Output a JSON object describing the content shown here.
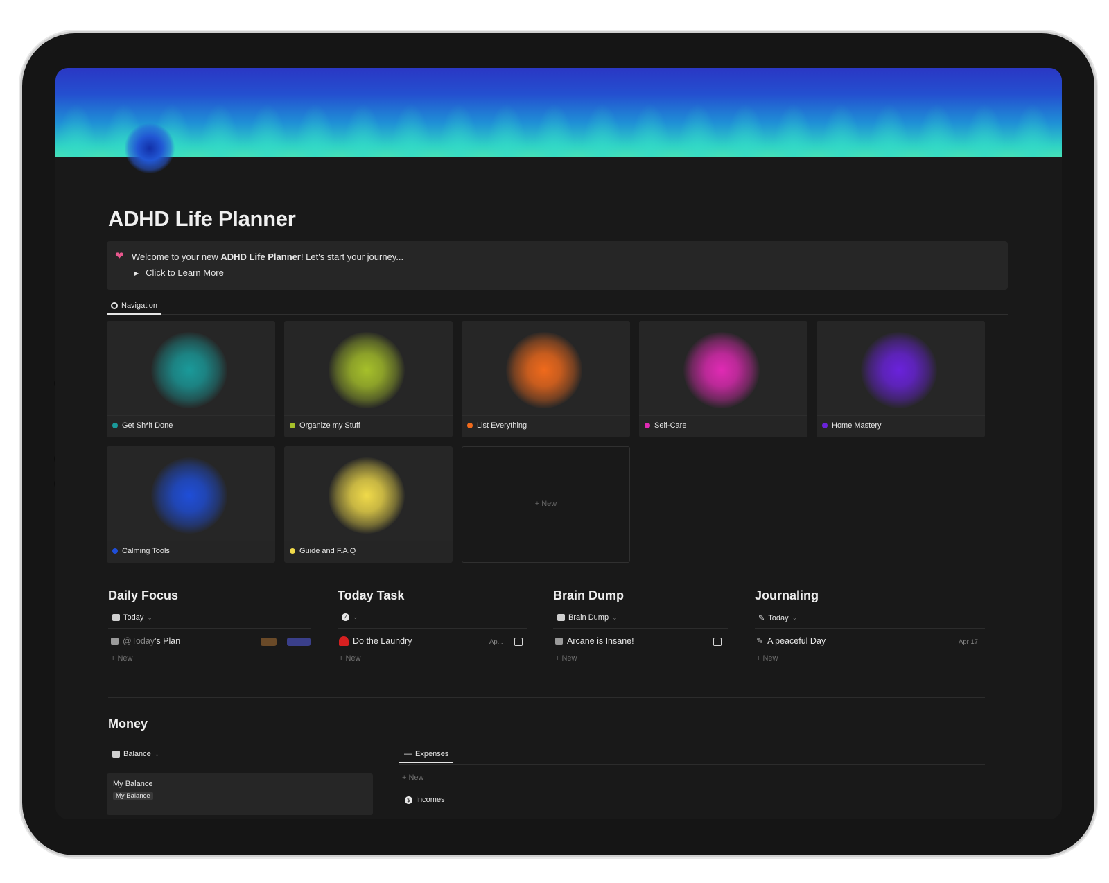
{
  "page": {
    "title": "ADHD Life Planner"
  },
  "callout": {
    "icon": "sparkling-heart-icon",
    "text_before": "Welcome to your new ",
    "text_bold": "ADHD Life Planner",
    "text_after": "! Let's start your journey...",
    "toggle_label": "Click to Learn More"
  },
  "tabs": {
    "navigation": "Navigation"
  },
  "gallery": {
    "cards": [
      {
        "label": "Get Sh*it Done",
        "color": "#1a9a9a"
      },
      {
        "label": "Organize my Stuff",
        "color": "#a6c02a"
      },
      {
        "label": "List Everything",
        "color": "#f06a1c"
      },
      {
        "label": "Self-Care",
        "color": "#e02ab4"
      },
      {
        "label": "Home Mastery",
        "color": "#6a22dc"
      },
      {
        "label": "Calming Tools",
        "color": "#1f4ed8"
      },
      {
        "label": "Guide and F.A.Q",
        "color": "#f0da4a"
      }
    ],
    "new_label": "+ New"
  },
  "daily_focus": {
    "title": "Daily Focus",
    "view": "Today",
    "item": {
      "prefix": "@Today",
      "suffix": "'s Plan"
    },
    "new_label": "+ New"
  },
  "today_task": {
    "title": "Today Task",
    "item": "Do the Laundry",
    "date": "Ap...",
    "new_label": "+ New"
  },
  "brain_dump": {
    "title": "Brain Dump",
    "view": "Brain Dump",
    "item": "Arcane is Insane!",
    "new_label": "+ New"
  },
  "journaling": {
    "title": "Journaling",
    "view": "Today",
    "item": "A peaceful Day",
    "date": "Apr 17",
    "new_label": "+ New"
  },
  "money": {
    "title": "Money",
    "balance_view": "Balance",
    "balance_card_title": "My Balance",
    "balance_card_tag": "My Balance",
    "expenses_tab": "Expenses",
    "new_label": "+ New",
    "incomes_label": "Incomes"
  }
}
